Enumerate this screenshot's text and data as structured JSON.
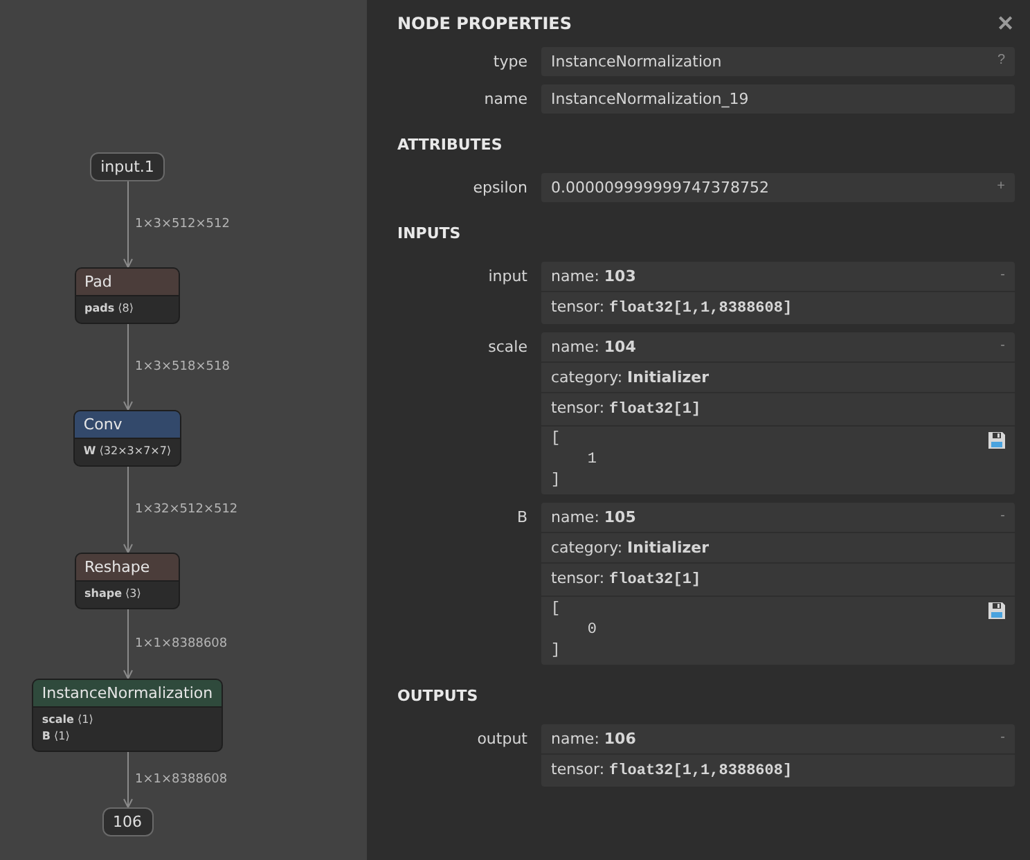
{
  "graph": {
    "nodes": [
      {
        "kind": "io",
        "label": "input.1"
      },
      {
        "kind": "op",
        "label": "Pad",
        "color": "#4b3d3a",
        "attributes": [
          {
            "name": "pads",
            "value": "⟨8⟩"
          }
        ]
      },
      {
        "kind": "op",
        "label": "Conv",
        "color": "#33496b",
        "attributes": [
          {
            "name": "W",
            "value": "⟨32×3×7×7⟩"
          }
        ]
      },
      {
        "kind": "op",
        "label": "Reshape",
        "color": "#4b3d3a",
        "attributes": [
          {
            "name": "shape",
            "value": "⟨3⟩"
          }
        ]
      },
      {
        "kind": "op",
        "label": "InstanceNormalization",
        "color": "#2f4a3c",
        "attributes": [
          {
            "name": "scale",
            "value": "⟨1⟩"
          },
          {
            "name": "B",
            "value": "⟨1⟩"
          }
        ]
      },
      {
        "kind": "io",
        "label": "106"
      }
    ],
    "edges": [
      "1×3×512×512",
      "1×3×518×518",
      "1×32×512×512",
      "1×1×8388608",
      "1×1×8388608"
    ]
  },
  "panel": {
    "title": "NODE PROPERTIES",
    "close": "✕",
    "sections": [
      {
        "rows": [
          {
            "label": "type",
            "toggle": "?",
            "lines": [
              {
                "kind": "plain",
                "value": "InstanceNormalization"
              }
            ]
          },
          {
            "label": "name",
            "lines": [
              {
                "kind": "plain",
                "value": "InstanceNormalization_19"
              }
            ]
          }
        ]
      },
      {
        "title": "ATTRIBUTES",
        "rows": [
          {
            "label": "epsilon",
            "toggle": "+",
            "lines": [
              {
                "kind": "plain",
                "value": "0.000009999999747378752"
              }
            ]
          }
        ]
      },
      {
        "title": "INPUTS",
        "rows": [
          {
            "label": "input",
            "toggle": "-",
            "lines": [
              {
                "kind": "field",
                "key": "name:",
                "value": "103"
              },
              {
                "kind": "tensor",
                "key": "tensor:",
                "value": "float32[1,1,8388608]"
              }
            ]
          },
          {
            "label": "scale",
            "toggle": "-",
            "lines": [
              {
                "kind": "field",
                "key": "name:",
                "value": "104"
              },
              {
                "kind": "field",
                "key": "category:",
                "value": "Initializer"
              },
              {
                "kind": "tensor",
                "key": "tensor:",
                "value": "float32[1]"
              },
              {
                "kind": "data",
                "value": "[\n    1\n]"
              }
            ]
          },
          {
            "label": "B",
            "toggle": "-",
            "lines": [
              {
                "kind": "field",
                "key": "name:",
                "value": "105"
              },
              {
                "kind": "field",
                "key": "category:",
                "value": "Initializer"
              },
              {
                "kind": "tensor",
                "key": "tensor:",
                "value": "float32[1]"
              },
              {
                "kind": "data",
                "value": "[\n    0\n]"
              }
            ]
          }
        ]
      },
      {
        "title": "OUTPUTS",
        "rows": [
          {
            "label": "output",
            "toggle": "-",
            "lines": [
              {
                "kind": "field",
                "key": "name:",
                "value": "106"
              },
              {
                "kind": "tensor",
                "key": "tensor:",
                "value": "float32[1,1,8388608]"
              }
            ]
          }
        ]
      }
    ]
  }
}
